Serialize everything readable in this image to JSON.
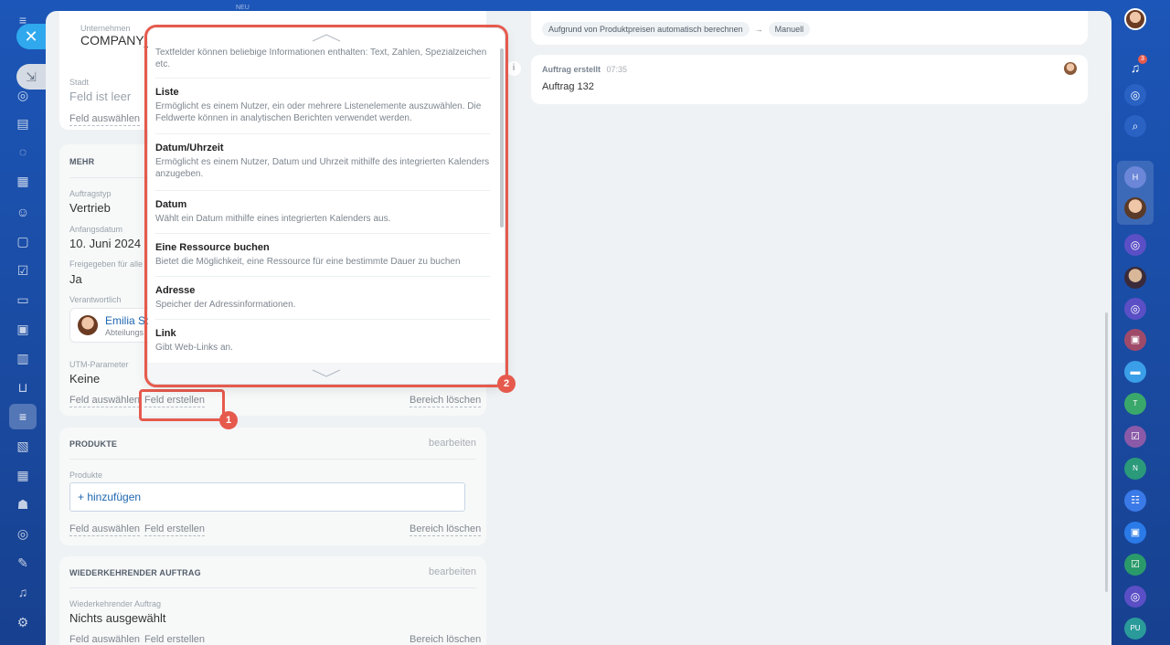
{
  "left_sidebar": {
    "new_badge": "NEU",
    "icons": [
      "menu-icon",
      "home-icon",
      "feed-icon",
      "doc-icon",
      "chat-icon",
      "calendar-icon",
      "contacts-icon",
      "file-icon",
      "task-icon",
      "card-icon",
      "presentation-icon",
      "analytics-icon",
      "cart-icon",
      "filter-icon",
      "gallery-icon",
      "calendar-grid-icon",
      "robot-icon",
      "target-icon",
      "edit-icon",
      "headset-icon",
      "gear-icon"
    ]
  },
  "top_card": {
    "company_label": "Unternehmen",
    "company_value": "COMPANY_",
    "city_label": "Stadt",
    "city_value": "Feld ist leer",
    "select_field": "Feld auswählen"
  },
  "more_section": {
    "title": "MEHR",
    "order_type_label": "Auftragstyp",
    "order_type_value": "Vertrieb",
    "start_date_label": "Anfangsdatum",
    "start_date_value": "10. Juni 2024",
    "shared_label": "Freigegeben für alle",
    "shared_value": "Ja",
    "responsible_label": "Verantwortlich",
    "responsible_name": "Emilia Sc",
    "responsible_dept": "Abteilungs",
    "utm_label": "UTM-Parameter",
    "utm_value": "Keine",
    "select_field": "Feld auswählen",
    "create_field": "Feld erstellen",
    "delete_section": "Bereich löschen"
  },
  "products_section": {
    "title": "PRODUKTE",
    "edit": "bearbeiten",
    "products_label": "Produkte",
    "add": "+ hinzufügen",
    "select_field": "Feld auswählen",
    "create_field": "Feld erstellen",
    "delete_section": "Bereich löschen"
  },
  "recurring_section": {
    "title": "WIEDERKEHRENDER AUFTRAG",
    "edit": "bearbeiten",
    "label": "Wiederkehrender Auftrag",
    "value": "Nichts ausgewählt",
    "select_field": "Feld auswählen",
    "create_field": "Feld erstellen",
    "delete_section": "Bereich löschen"
  },
  "timeline": {
    "chip_from": "Aufgrund von Produktpreisen automatisch berechnen",
    "chip_arrow": "→",
    "chip_to": "Manuell",
    "event_title": "Auftrag erstellt",
    "event_time": "07:35",
    "event_body": "Auftrag 132"
  },
  "dropdown": {
    "items": [
      {
        "title": "",
        "desc": "Textfelder können beliebige Informationen enthalten: Text, Zahlen, Spezialzeichen etc."
      },
      {
        "title": "Liste",
        "desc": "Ermöglicht es einem Nutzer, ein oder mehrere Listenelemente auszuwählen. Die Feldwerte können in analytischen Berichten verwendet werden."
      },
      {
        "title": "Datum/Uhrzeit",
        "desc": "Ermöglicht es einem Nutzer, Datum und Uhrzeit mithilfe des integrierten Kalenders anzugeben."
      },
      {
        "title": "Datum",
        "desc": "Wählt ein Datum mithilfe eines integrierten Kalenders aus."
      },
      {
        "title": "Eine Ressource buchen",
        "desc": "Bietet die Möglichkeit, eine Ressource für eine bestimmte Dauer zu buchen"
      },
      {
        "title": "Adresse",
        "desc": "Speicher der Adressinformationen."
      },
      {
        "title": "Link",
        "desc": "Gibt Web-Links an."
      }
    ]
  },
  "annotations": {
    "badge_1": "1",
    "badge_2": "2"
  },
  "right_rail": {
    "notification_count": "3",
    "avatars": [
      "H",
      "T",
      "N",
      "PU"
    ]
  },
  "colors": {
    "highlight": "#e65a4d",
    "accent_blue": "#2fa8ee",
    "link_blue": "#2067b0"
  }
}
